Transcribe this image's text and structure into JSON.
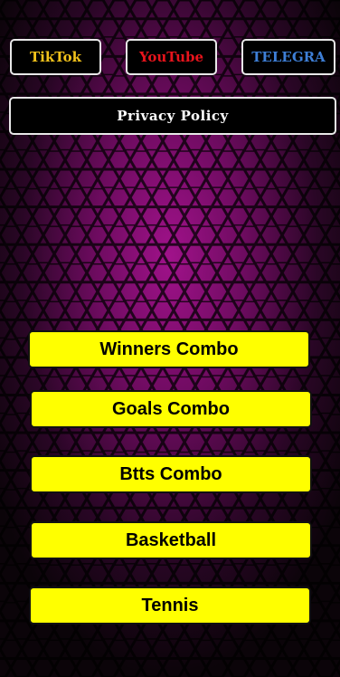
{
  "theme": {
    "background": "#0b0409",
    "glow": "#a0128a",
    "social_bg": "#000000",
    "menu_bg": "#ffff00"
  },
  "social": {
    "tiktok": {
      "label": "TikTok",
      "color": "#f2c21b"
    },
    "youtube": {
      "label": "YouTube",
      "color": "#e8141c"
    },
    "telegram": {
      "label": "TELEGRA",
      "color": "#3e7fd6"
    }
  },
  "privacy": {
    "label": "Privacy Policy"
  },
  "menu": {
    "items": [
      {
        "label": "Winners Combo"
      },
      {
        "label": "Goals Combo"
      },
      {
        "label": "Btts Combo"
      },
      {
        "label": "Basketball"
      },
      {
        "label": "Tennis"
      }
    ]
  },
  "icons": {
    "background": "hexagon-mesh-pattern"
  }
}
